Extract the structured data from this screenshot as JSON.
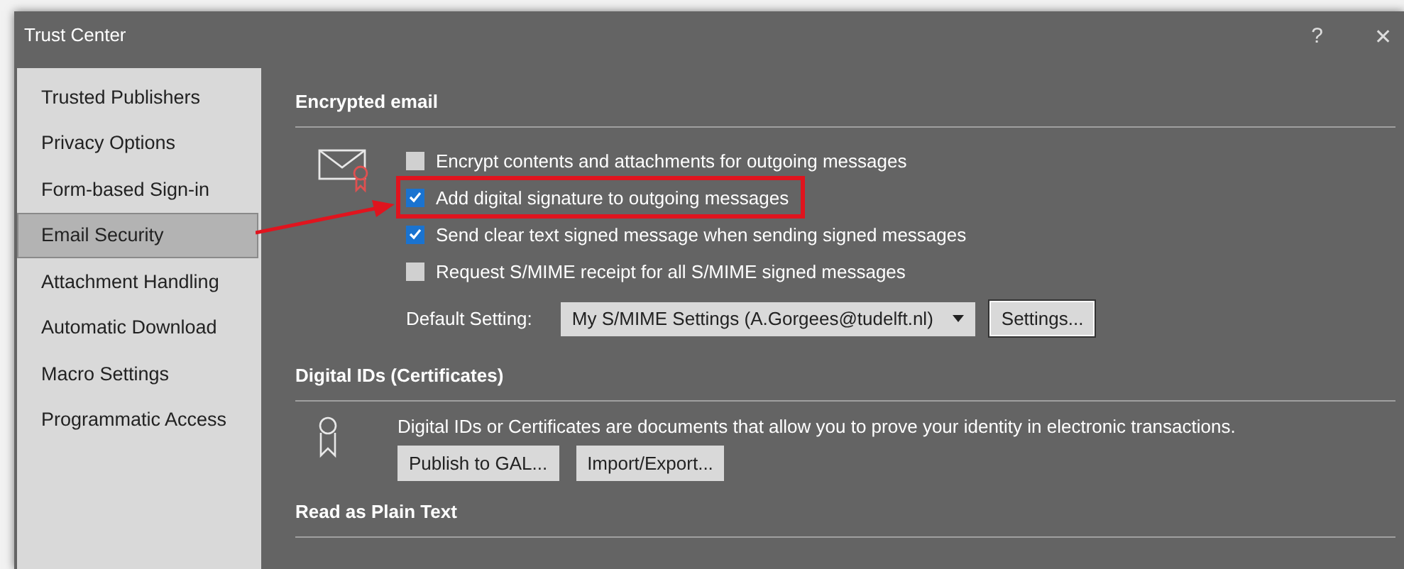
{
  "window": {
    "title": "Trust Center",
    "help": "?",
    "close": "✕"
  },
  "sidebar": {
    "items": [
      {
        "label": "Trusted Publishers",
        "selected": false
      },
      {
        "label": "Privacy Options",
        "selected": false
      },
      {
        "label": "Form-based Sign-in",
        "selected": false
      },
      {
        "label": "Email Security",
        "selected": true
      },
      {
        "label": "Attachment Handling",
        "selected": false
      },
      {
        "label": "Automatic Download",
        "selected": false
      },
      {
        "label": "Macro Settings",
        "selected": false
      },
      {
        "label": "Programmatic Access",
        "selected": false
      }
    ]
  },
  "encrypted_email": {
    "heading": "Encrypted email",
    "options": [
      {
        "label": "Encrypt contents and attachments for outgoing messages",
        "checked": false,
        "highlighted": false
      },
      {
        "label": "Add digital signature to outgoing messages",
        "checked": true,
        "highlighted": true
      },
      {
        "label": "Send clear text signed message when sending signed messages",
        "checked": true,
        "highlighted": false
      },
      {
        "label": "Request S/MIME receipt for all S/MIME signed messages",
        "checked": false,
        "highlighted": false
      }
    ],
    "default_setting": {
      "label": "Default Setting:",
      "value": "My S/MIME Settings (A.Gorgees@tudelft.nl)",
      "button": "Settings..."
    }
  },
  "digital_ids": {
    "heading": "Digital IDs (Certificates)",
    "description": "Digital IDs or Certificates are documents that allow you to prove your identity in electronic transactions.",
    "buttons": [
      "Publish to GAL...",
      "Import/Export..."
    ]
  },
  "read_as_plain_text": {
    "heading": "Read as Plain Text"
  }
}
